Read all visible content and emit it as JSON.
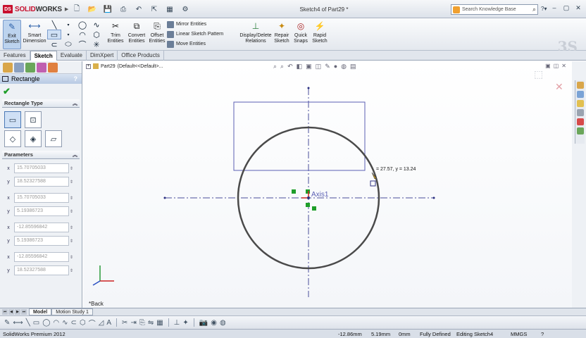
{
  "app": {
    "brand_prefix": "SOLID",
    "brand_suffix": "WORKS",
    "document_title": "Sketch4 of Part29 *"
  },
  "search": {
    "placeholder": "Search Knowledge Base"
  },
  "command_manager": {
    "exit_sketch": "Exit Sketch",
    "smart_dimension": "Smart Dimension",
    "trim_entities": "Trim Entities",
    "convert_entities": "Convert Entities",
    "offset_entities": "Offset Entities",
    "mirror_entities": "Mirror Entities",
    "linear_sketch_pattern": "Linear Sketch Pattern",
    "move_entities": "Move Entities",
    "display_delete_relations": "Display/Delete Relations",
    "repair_sketch": "Repair Sketch",
    "quick_snaps": "Quick Snaps",
    "rapid_sketch": "Rapid Sketch"
  },
  "tabs": [
    "Features",
    "Sketch",
    "Evaluate",
    "DimXpert",
    "Office Products"
  ],
  "active_tab": "Sketch",
  "property_manager": {
    "title": "Rectangle",
    "help": "?",
    "rectangle_type_title": "Rectangle Type",
    "parameters_title": "Parameters",
    "parameters": [
      {
        "axis": "x",
        "value": "15.70705033"
      },
      {
        "axis": "y",
        "value": "18.52327588"
      },
      {
        "axis": "x",
        "value": "15.70705033"
      },
      {
        "axis": "y",
        "value": "5.19386723"
      },
      {
        "axis": "x",
        "value": "-12.85596842"
      },
      {
        "axis": "y",
        "value": "5.19386723"
      },
      {
        "axis": "x",
        "value": "-12.85596842"
      },
      {
        "axis": "y",
        "value": "18.52327588"
      }
    ]
  },
  "viewport": {
    "tree_part": "Part29",
    "tree_config": "(Default<<Default>...",
    "axis_label": "Axis1",
    "cursor_readout": "= 27.57, y = 13.24",
    "orientation_label": "*Back"
  },
  "bottom_tabs": [
    "Model",
    "Motion Study 1"
  ],
  "active_bottom_tab": "Model",
  "status_bar": {
    "product": "SolidWorks Premium 2012",
    "x": "-12.86mm",
    "y": "5.19mm",
    "z": "0mm",
    "state": "Fully Defined",
    "editing": "Editing Sketch4",
    "units": "MMGS",
    "help": "?"
  },
  "colors": {
    "accent": "#4a78b5",
    "brand_red": "#c8102e",
    "relation_green": "#1f9e2a",
    "sketch_blue": "#5b5fb4",
    "circle_gray": "#4a4a4a"
  }
}
